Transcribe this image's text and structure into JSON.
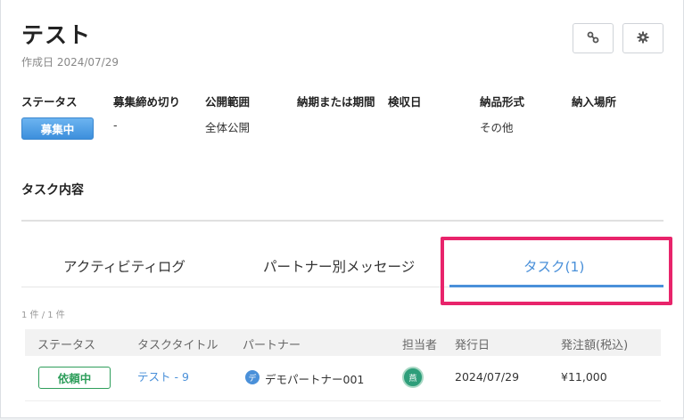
{
  "header": {
    "title": "テスト",
    "created": "作成日 2024/07/29"
  },
  "toolbar": {
    "link_icon": "link-icon",
    "settings_icon": "gear-icon"
  },
  "meta": {
    "labels": [
      "ステータス",
      "募集締め切り",
      "公開範囲",
      "納期または期間",
      "検収日",
      "納品形式",
      "納入場所"
    ],
    "status": "募集中",
    "deadline": "-",
    "visibility": "全体公開",
    "delivery_format": "その他"
  },
  "section": {
    "title": "タスク内容"
  },
  "tabs": [
    {
      "label": "アクティビティログ",
      "active": false
    },
    {
      "label": "パートナー別メッセージ",
      "active": false
    },
    {
      "label": "タスク(1)",
      "active": true
    }
  ],
  "pagination": {
    "count": "1 件 / 1 件"
  },
  "table": {
    "headers": [
      "ステータス",
      "タスクタイトル",
      "パートナー",
      "担当者",
      "発行日",
      "発注額(税込)"
    ],
    "rows": [
      {
        "status": "依頼中",
        "title": "テスト - 9",
        "partner_initial": "デ",
        "partner": "デモパートナー001",
        "assignee_initial": "燕",
        "issue_date": "2024/07/29",
        "amount": "¥11,000"
      }
    ]
  },
  "colors": {
    "accent": "#4a90d9",
    "success": "#2e9e5b",
    "highlight": "#e8246b"
  }
}
